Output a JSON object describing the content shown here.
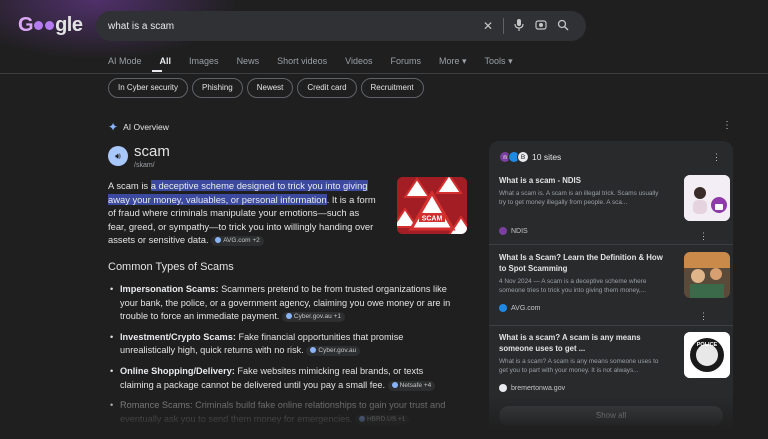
{
  "logo": {
    "text": "Google"
  },
  "search": {
    "query": "what is a scam"
  },
  "icons": [
    "close-icon",
    "mic-icon",
    "lens-icon",
    "search-icon"
  ],
  "tabs": [
    {
      "label": "AI Mode"
    },
    {
      "label": "All"
    },
    {
      "label": "Images"
    },
    {
      "label": "News"
    },
    {
      "label": "Short videos"
    },
    {
      "label": "Videos"
    },
    {
      "label": "Forums"
    },
    {
      "label": "More"
    },
    {
      "label": "Tools"
    }
  ],
  "chips": [
    "In Cyber security",
    "Phishing",
    "Newest",
    "Credit card",
    "Recruitment"
  ],
  "ai_overview": {
    "label": "AI Overview",
    "word": "scam",
    "phonetic": "/skam/",
    "definition_pre": "A scam is ",
    "definition_highlight": "a deceptive scheme designed to trick you into giving away your money, valuables, or personal information",
    "definition_post": ". It is a form of fraud where criminals manipulate your emotions—such as fear, greed, or sympathy—to trick you into willingly handing over assets or sensitive data.",
    "definition_source": "AVG.com +2",
    "image_text": "SCAM",
    "heading": "Common Types of Scams",
    "types": [
      {
        "title": "Impersonation Scams:",
        "text": " Scammers pretend to be from trusted organizations like your bank, the police, or a government agency, claiming you owe money or are in trouble to force an immediate payment.",
        "source": "Cyber.gov.au +1"
      },
      {
        "title": "Investment/Crypto Scams:",
        "text": " Fake financial opportunities that promise unrealistically high, quick returns with no risk.",
        "source": "Cyber.gov.au"
      },
      {
        "title": "Online Shopping/Delivery:",
        "text": " Fake websites mimicking real brands, or texts claiming a package cannot be delivered until you pay a small fee.",
        "source": "Netsafe +4"
      },
      {
        "title": "Romance Scams:",
        "text": " Criminals build fake online relationships to gain your trust and eventually ask you to send them money for emergencies.",
        "source": "HBRD.US +1"
      }
    ]
  },
  "sites_panel": {
    "count_label": "10 sites",
    "cards": [
      {
        "title": "What is a scam - NDIS",
        "snippet": "What a scam is. A scam is an illegal trick. Scams usually try to get money illegally from people. A sca...",
        "source": "NDIS"
      },
      {
        "title": "What Is a Scam? Learn the Definition & How to Spot Scamming",
        "snippet": "4 Nov 2024 — A scam is a deceptive scheme where someone tries to trick you into giving them money,...",
        "source": "AVG.com"
      },
      {
        "title": "What is a scam? A scam is any means someone uses to get ...",
        "snippet": "What is a scam? A scam is any means someone uses to get you to part with your money. It is not always...",
        "source": "bremertonwa.gov",
        "thumb_text": "POLICE"
      }
    ],
    "show_all": "Show all"
  },
  "colors": {
    "background": "#1f1f1f",
    "highlight": "#3b4a9e",
    "accent": "#8ab4f8"
  }
}
